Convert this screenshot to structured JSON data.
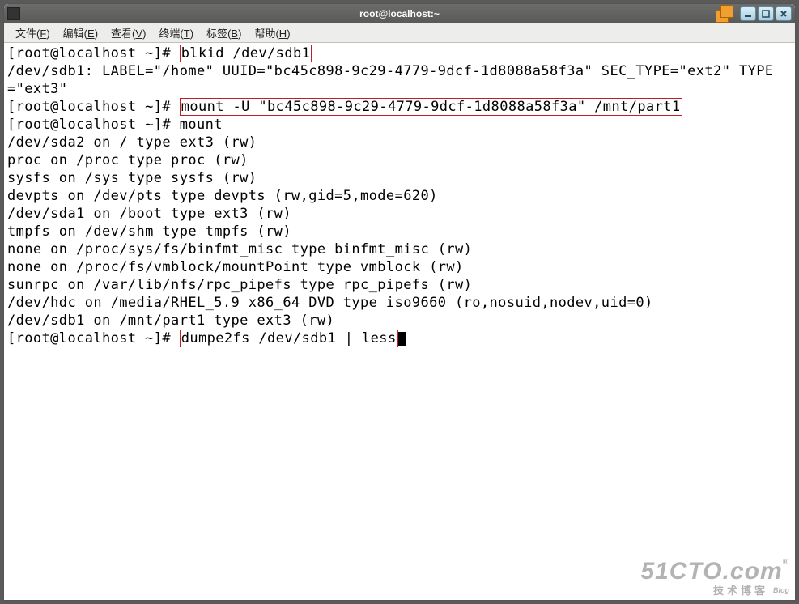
{
  "window": {
    "title": "root@localhost:~"
  },
  "menubar": {
    "file": {
      "label": "文件",
      "accel": "F"
    },
    "edit": {
      "label": "编辑",
      "accel": "E"
    },
    "view": {
      "label": "查看",
      "accel": "V"
    },
    "terminal": {
      "label": "终端",
      "accel": "T"
    },
    "tabs": {
      "label": "标签",
      "accel": "B"
    },
    "help": {
      "label": "帮助",
      "accel": "H"
    }
  },
  "terminal": {
    "prompt": "[root@localhost ~]# ",
    "cmd1": "blkid /dev/sdb1",
    "out1": "/dev/sdb1: LABEL=\"/home\" UUID=\"bc45c898-9c29-4779-9dcf-1d8088a58f3a\" SEC_TYPE=\"ext2\" TYPE=\"ext3\"",
    "cmd2": "mount -U \"bc45c898-9c29-4779-9dcf-1d8088a58f3a\" /mnt/part1",
    "cmd3": "mount",
    "mountlines": [
      "/dev/sda2 on / type ext3 (rw)",
      "proc on /proc type proc (rw)",
      "sysfs on /sys type sysfs (rw)",
      "devpts on /dev/pts type devpts (rw,gid=5,mode=620)",
      "/dev/sda1 on /boot type ext3 (rw)",
      "tmpfs on /dev/shm type tmpfs (rw)",
      "none on /proc/sys/fs/binfmt_misc type binfmt_misc (rw)",
      "none on /proc/fs/vmblock/mountPoint type vmblock (rw)",
      "sunrpc on /var/lib/nfs/rpc_pipefs type rpc_pipefs (rw)",
      "/dev/hdc on /media/RHEL_5.9 x86_64 DVD type iso9660 (ro,nosuid,nodev,uid=0)",
      "/dev/sdb1 on /mnt/part1 type ext3 (rw)"
    ],
    "cmd4": "dumpe2fs /dev/sdb1 | less"
  },
  "watermark": {
    "brand": "51CTO",
    "suffix": ".com",
    "sub": "技术博客",
    "blog": "Blog"
  }
}
